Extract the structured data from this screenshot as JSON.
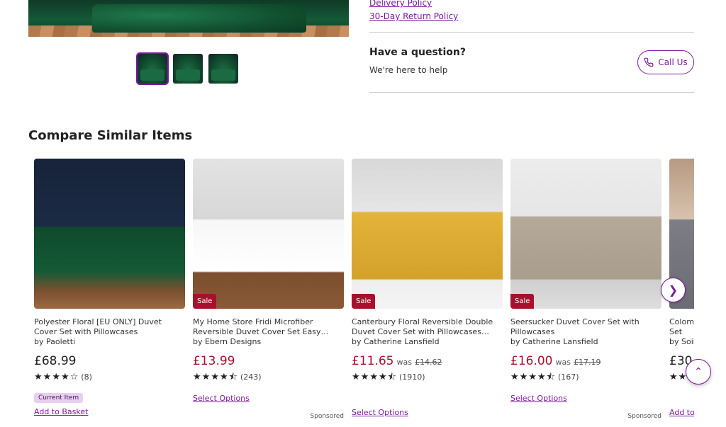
{
  "policies": {
    "delivery": "Delivery Policy",
    "returns": "30-Day Return Policy"
  },
  "help": {
    "title": "Have a question?",
    "subtitle": "We're here to help",
    "call_label": "Call Us"
  },
  "section_title": "Compare Similar Items",
  "products": [
    {
      "name": "Polyester Floral [EU ONLY] Duvet Cover Set with Pillowcases",
      "by": "by Paoletti",
      "price": "£68.99",
      "was": "",
      "rating": 4,
      "count": "(8)",
      "badge": "Current Item",
      "action": "Add to Basket",
      "sale": "",
      "sponsored": ""
    },
    {
      "name": "My Home Store Fridi Microfiber Reversible Duvet Cover Set Easy Care...",
      "by": "by Ebern Designs",
      "price": "£13.99",
      "was": "",
      "rating": 4.5,
      "count": "(243)",
      "badge": "",
      "action": "Select Options",
      "sale": "Sale",
      "sponsored": "Sponsored"
    },
    {
      "name": "Canterbury Floral Reversible Double Duvet Cover Set with Pillowcases with...",
      "by": "by Catherine Lansfield",
      "price": "£11.65",
      "was_prefix": "was",
      "was": "£14.62",
      "rating": 4.5,
      "count": "(1910)",
      "badge": "",
      "action": "Select Options",
      "sale": "Sale",
      "sponsored": ""
    },
    {
      "name": "Seersucker Duvet Cover Set with Pillowcases",
      "by": "by Catherine Lansfield",
      "price": "£16.00",
      "was_prefix": "was",
      "was": "£17.19",
      "rating": 4.5,
      "count": "(167)",
      "badge": "",
      "action": "Select Options",
      "sale": "Sale",
      "sponsored": "Sponsored"
    },
    {
      "name": "Colombo Ultra [EU ONLY] Duvet Cover Set",
      "by": "by Soiree",
      "price": "£30",
      "was": "",
      "rating": 4,
      "count": "",
      "badge": "",
      "action": "Add to Basket",
      "sale": "",
      "sponsored": ""
    }
  ],
  "icons": {
    "phone": "phone-icon",
    "next": "chevron-right-icon",
    "top": "chevron-up-icon"
  },
  "colors": {
    "accent": "#7b189f",
    "sale": "#a8102e"
  }
}
